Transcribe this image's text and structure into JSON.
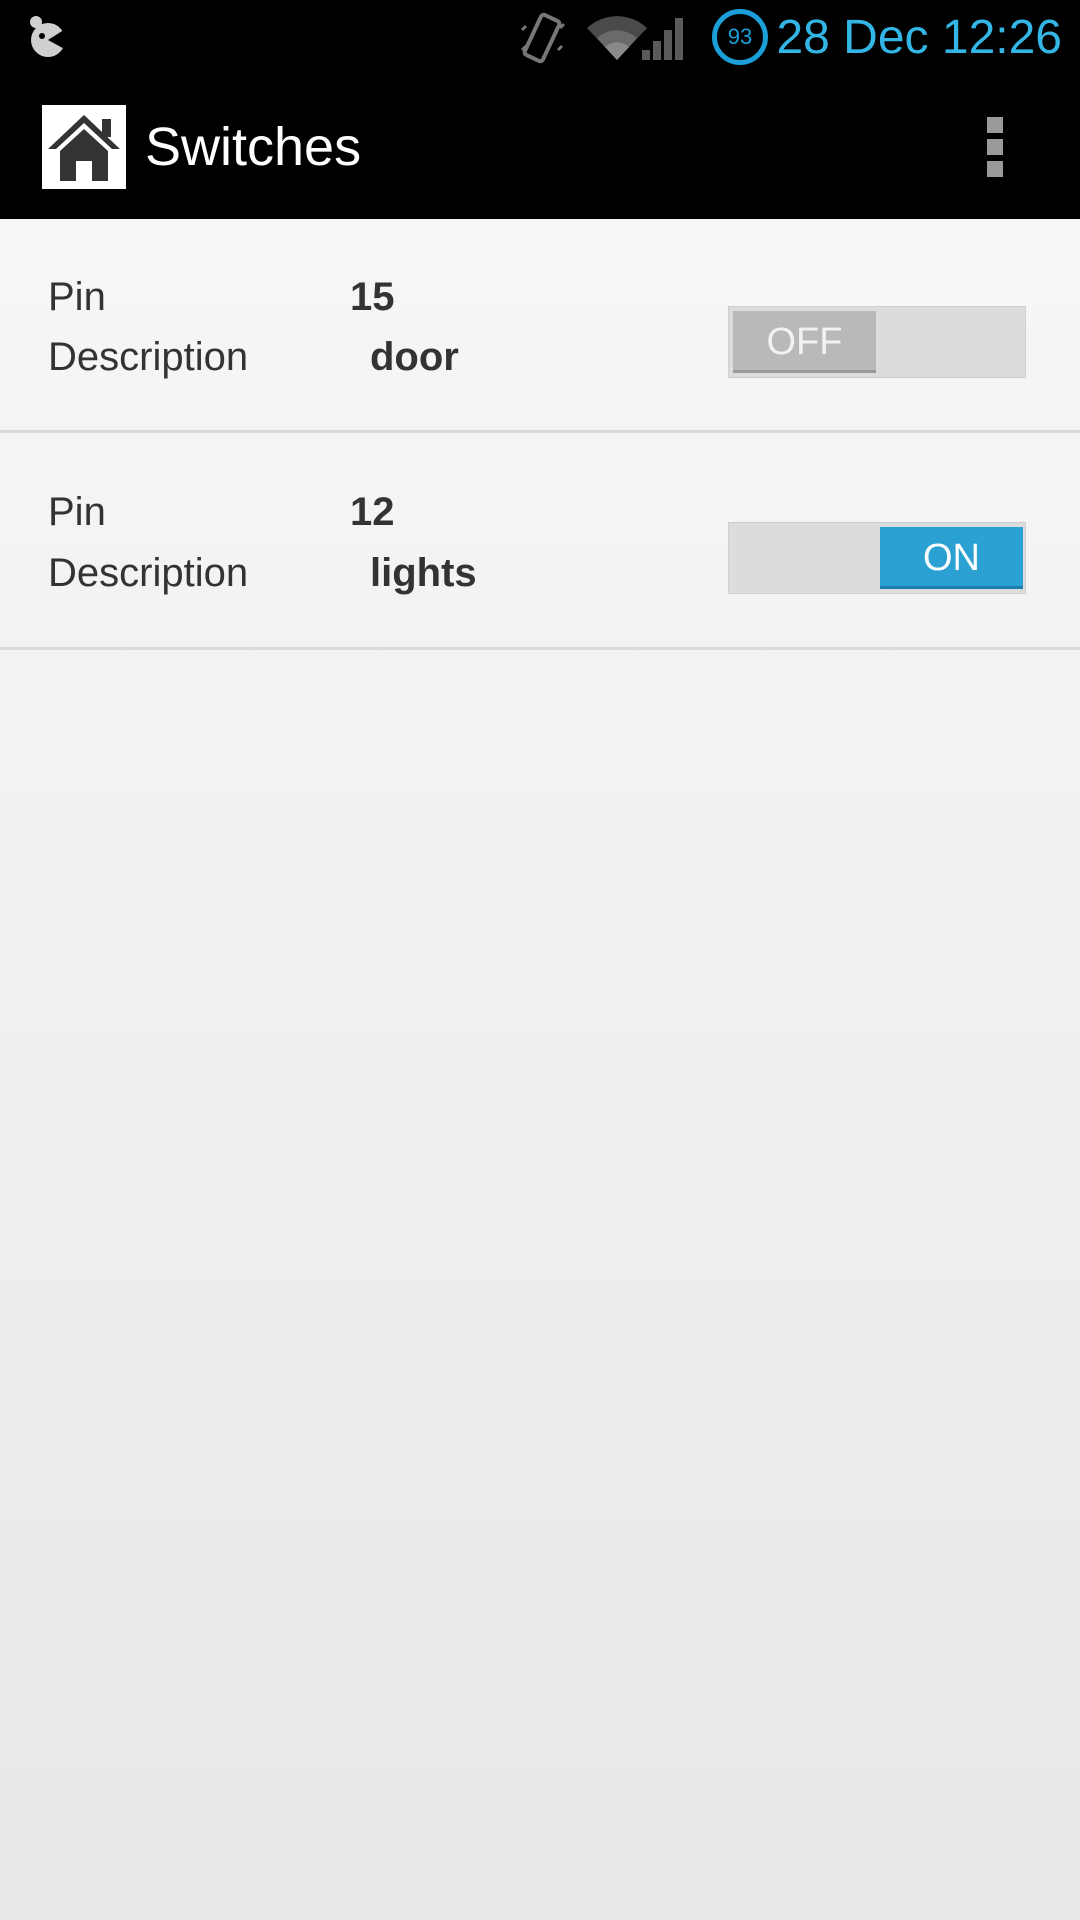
{
  "status_bar": {
    "notification_icon": "mouse-notification-icon",
    "vibrate_icon": "vibrate-icon",
    "wifi_icon": "wifi-icon",
    "signal_icon": "signal-icon",
    "battery_level": "93",
    "datetime": "28 Dec 12:26",
    "accent_color": "#33b5e5"
  },
  "action_bar": {
    "home_icon": "home-icon",
    "title": "Switches",
    "overflow_icon": "overflow-menu-icon"
  },
  "switches": [
    {
      "pin_label": "Pin",
      "pin_value": "15",
      "description_label": "Description",
      "description_value": "door",
      "toggle_label": "OFF",
      "state": "off"
    },
    {
      "pin_label": "Pin",
      "pin_value": "12",
      "description_label": "Description",
      "description_value": "lights",
      "toggle_label": "ON",
      "state": "on"
    }
  ],
  "colors": {
    "on_color": "#2aa0d3",
    "off_color": "#b9b9b9"
  }
}
